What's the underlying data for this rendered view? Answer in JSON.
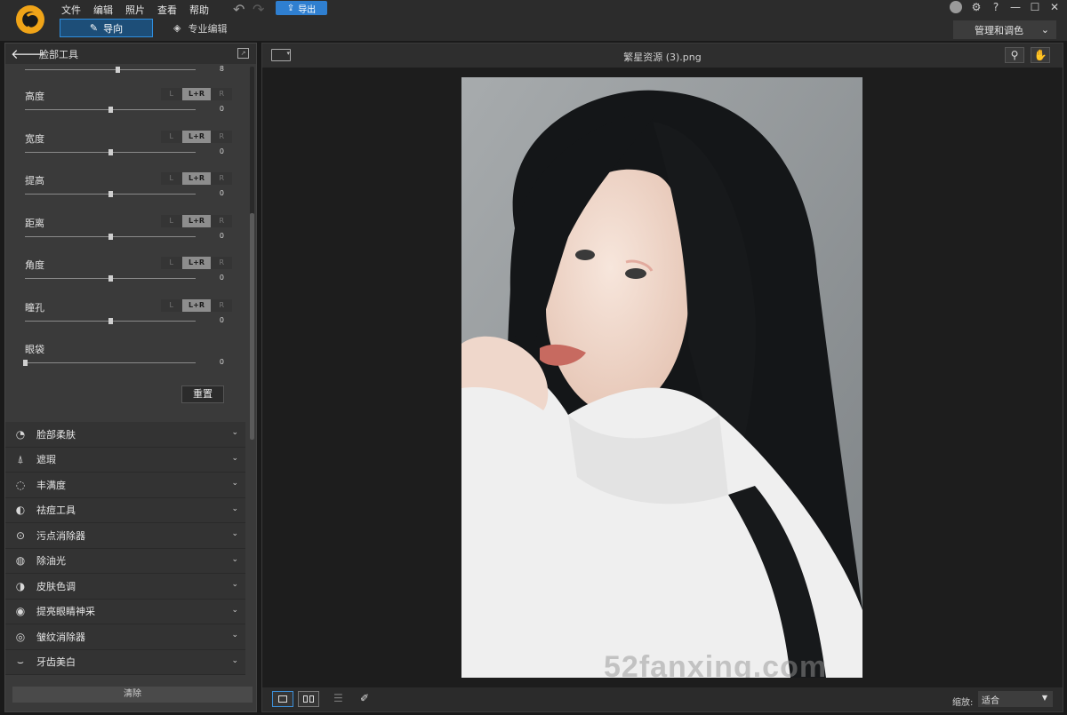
{
  "menu": [
    "文件",
    "编辑",
    "照片",
    "查看",
    "帮助"
  ],
  "toolbar": {
    "export_label": "导出"
  },
  "mode_tabs": {
    "guide": "导向",
    "pro": "专业编辑"
  },
  "window": {
    "help": "?",
    "manage_label": "管理和调色"
  },
  "panel": {
    "title": "脸部工具",
    "top_value": "8",
    "lr_labels": {
      "left": "L",
      "both": "L+R",
      "right": "R"
    },
    "sliders": [
      {
        "label": "高度",
        "value": "0",
        "level": 0.5,
        "lr": true
      },
      {
        "label": "宽度",
        "value": "0",
        "level": 0.5,
        "lr": true
      },
      {
        "label": "提高",
        "value": "0",
        "level": 0.5,
        "lr": true
      },
      {
        "label": "距离",
        "value": "0",
        "level": 0.5,
        "lr": true
      },
      {
        "label": "角度",
        "value": "0",
        "level": 0.5,
        "lr": true
      },
      {
        "label": "瞳孔",
        "value": "0",
        "level": 0.5,
        "lr": true
      },
      {
        "label": "眼袋",
        "value": "0",
        "level": 0.0,
        "lr": false
      }
    ],
    "top_level": 0.54,
    "reset_label": "重置",
    "tools": [
      {
        "label": "脸部柔肤",
        "icon": "face-brush-icon"
      },
      {
        "label": "遮瑕",
        "icon": "concealer-icon"
      },
      {
        "label": "丰满度",
        "icon": "volume-icon"
      },
      {
        "label": "祛痘工具",
        "icon": "acne-icon"
      },
      {
        "label": "污点消除器",
        "icon": "spot-remover-icon"
      },
      {
        "label": "除油光",
        "icon": "shine-removal-icon"
      },
      {
        "label": "皮肤色调",
        "icon": "skin-tone-icon"
      },
      {
        "label": "提亮眼睛神采",
        "icon": "eye-brighten-icon"
      },
      {
        "label": "皱纹消除器",
        "icon": "wrinkle-icon"
      },
      {
        "label": "牙齿美白",
        "icon": "teeth-whiten-icon"
      }
    ],
    "clear_label": "清除"
  },
  "viewer": {
    "filename": "繁星资源 (3).png",
    "watermark": "52fanxing.com",
    "zoom_label": "缩放:",
    "zoom_value": "适合"
  },
  "colors": {
    "accent": "#2f7fd0",
    "logo": "#f0a418"
  }
}
